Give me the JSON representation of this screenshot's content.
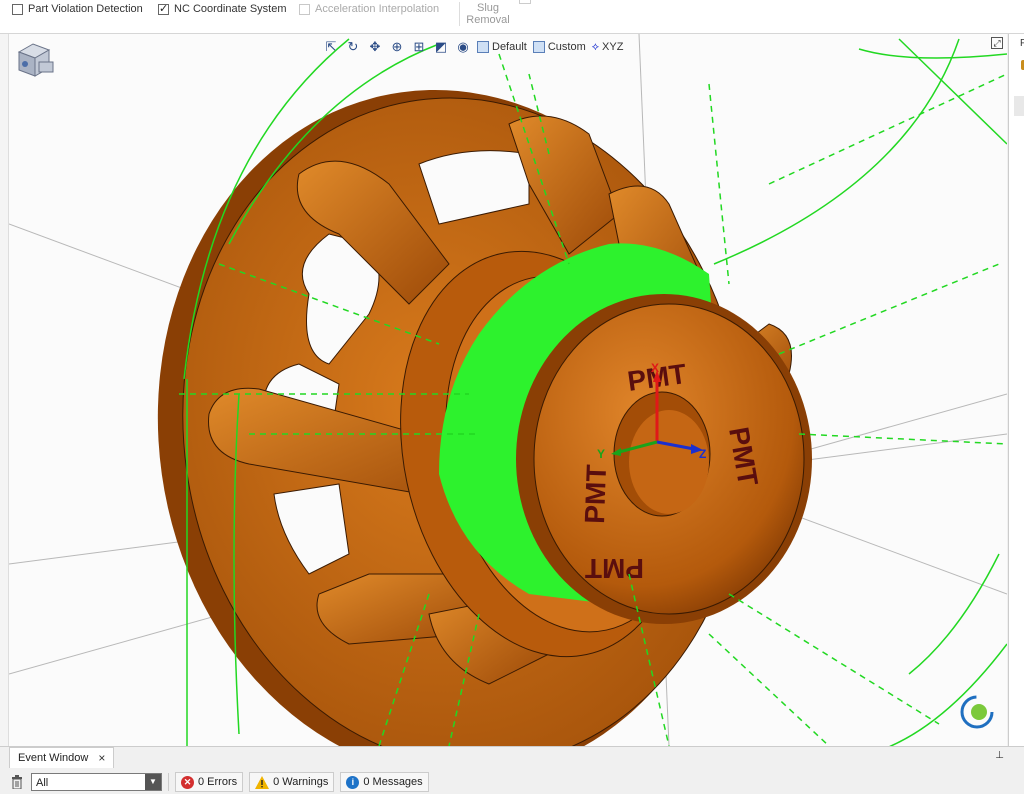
{
  "topbar": {
    "checks": [
      {
        "label": "Part Violation Detection",
        "checked": false,
        "enabled": true
      },
      {
        "label": "NC Coordinate System",
        "checked": true,
        "enabled": true
      },
      {
        "label": "Acceleration Interpolation",
        "checked": false,
        "enabled": false
      }
    ],
    "slug_line1": "Slug",
    "slug_line2": "Removal"
  },
  "viewport_toolbar": {
    "icons": [
      "select-icon",
      "rotate-icon",
      "pan-icon",
      "zoom-icon",
      "zoom-window-icon",
      "view-cube-icon",
      "eye-icon"
    ],
    "default_label": "Default",
    "custom_label": "Custom",
    "xyz_label": "XYZ"
  },
  "scene": {
    "engraving": "PMT",
    "axis_x": "X",
    "axis_y": "Y",
    "axis_z": "Z",
    "colors": {
      "part": "#c9640f",
      "part_dark": "#8f4206",
      "toolpath": "#22d822",
      "background": "#fbfbfb"
    }
  },
  "right_panel": {
    "letter": "P"
  },
  "event_window": {
    "tab_label": "Event Window",
    "close_symbol": "×",
    "pin_symbol": "⊥",
    "filter_value": "All",
    "errors_label": "0 Errors",
    "warnings_label": "0 Warnings",
    "messages_label": "0 Messages"
  }
}
